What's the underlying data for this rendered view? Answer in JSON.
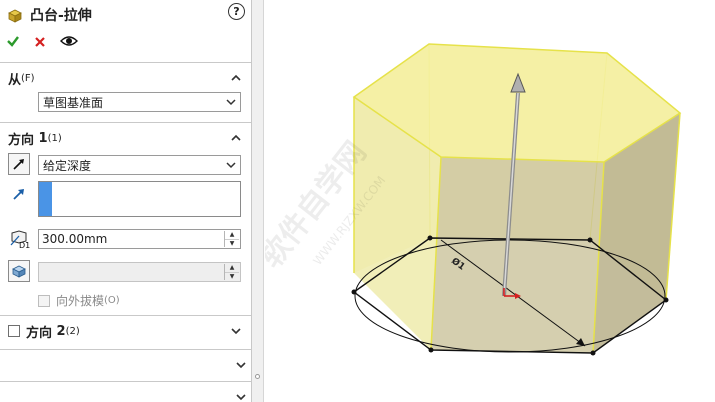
{
  "feature": {
    "title": "凸台-拉伸",
    "help_symbol": "?",
    "ok_icon": "checkmark-icon",
    "cancel_icon": "x-icon",
    "preview_icon": "eye-icon"
  },
  "from": {
    "label": "从",
    "shortcut": "(F)",
    "value": "草图基准面"
  },
  "direction1": {
    "label": "方向",
    "label_number": "1",
    "shortcut": "(1)",
    "end_condition": "给定深度",
    "depth": "300.00mm",
    "draft_outward": "向外拔模",
    "draft_shortcut": "(O)"
  },
  "direction2": {
    "label": "方向",
    "label_number": "2",
    "shortcut": "(2)"
  },
  "viewport": {
    "dimension_label": "Ø1",
    "watermark_cn": "软件自学网",
    "watermark_url": "WWW.RJZXW.COM"
  },
  "colors": {
    "accent_blue": "#4a94e6",
    "ok_green": "#2c9a2c",
    "cancel_red": "#d42020",
    "preview_yellow": "#f4f0a0",
    "preview_edge": "#e6e24a"
  }
}
